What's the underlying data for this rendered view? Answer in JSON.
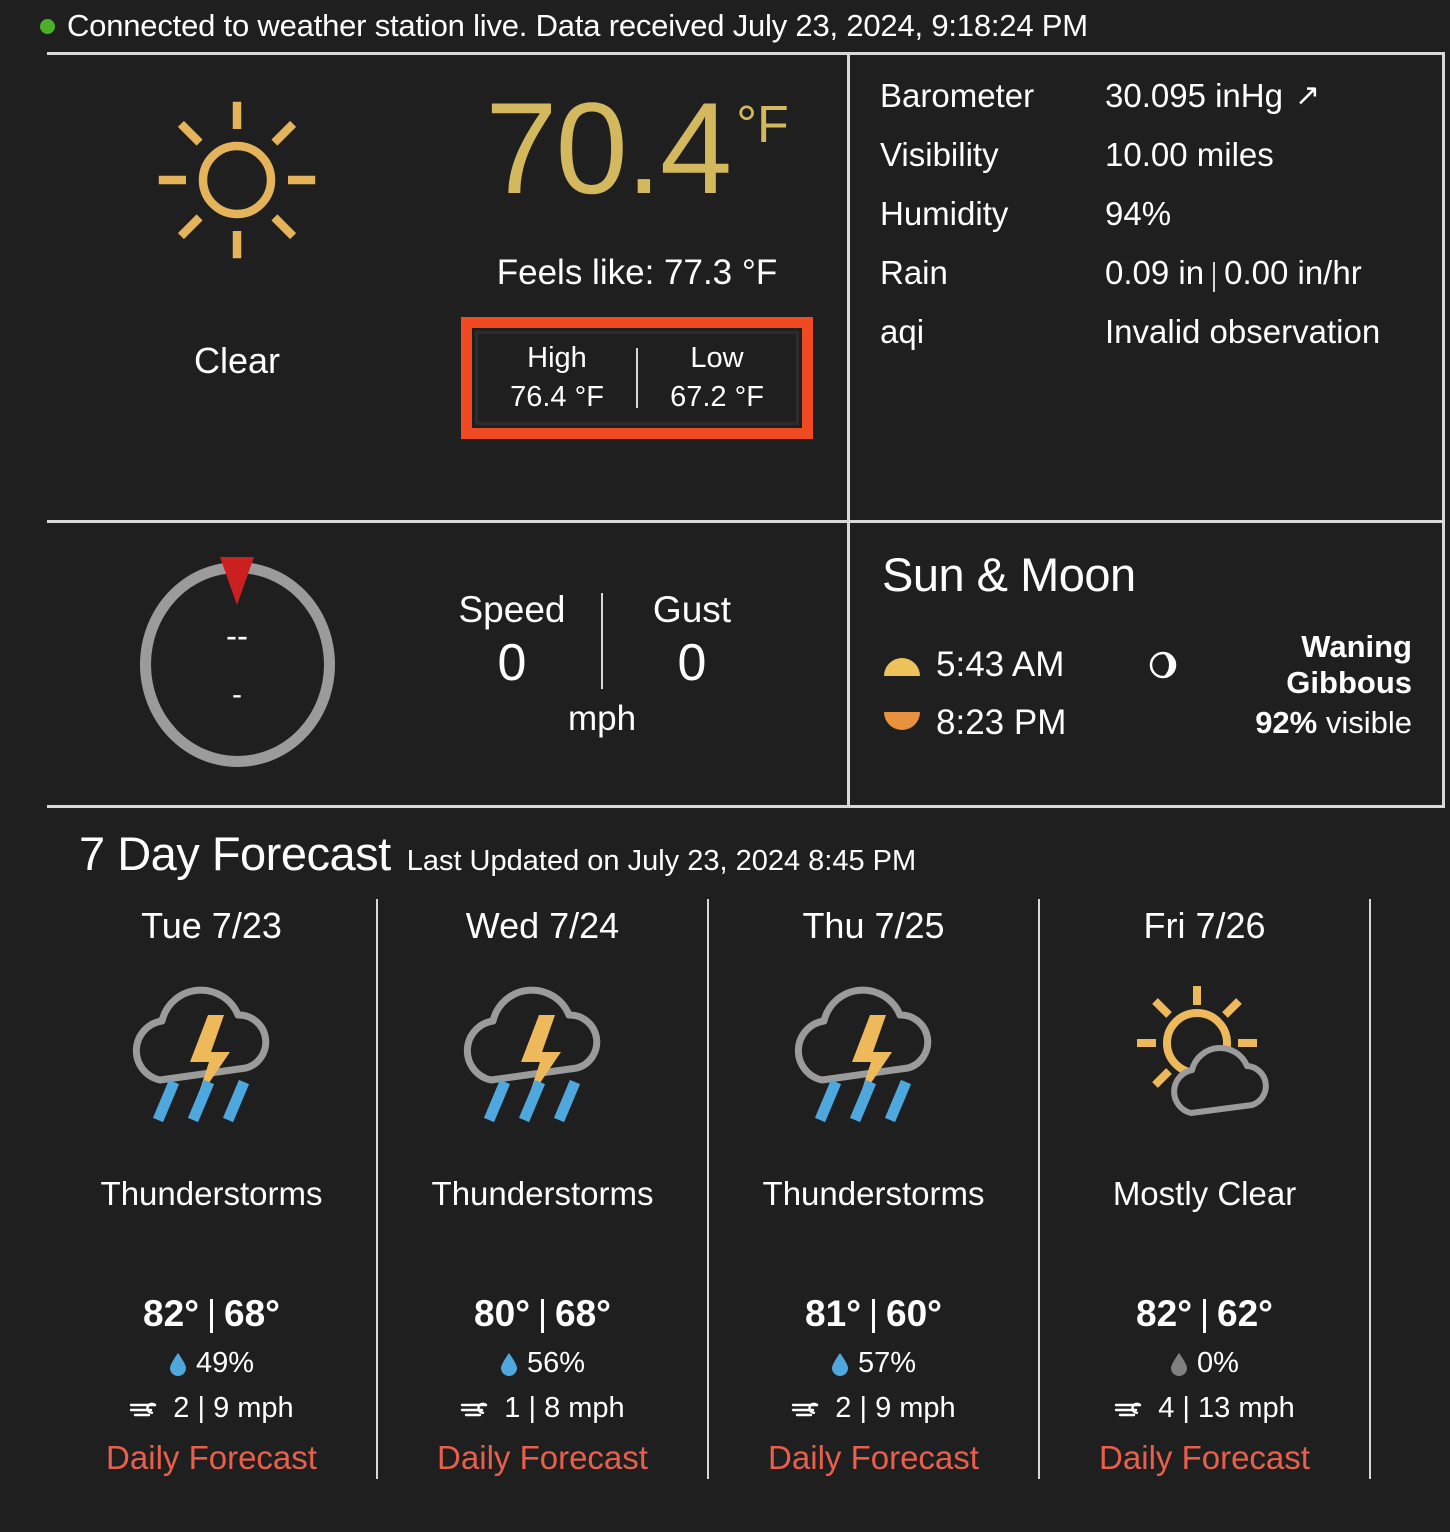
{
  "status": {
    "indicator_color": "#4caf28",
    "text": "Connected to weather station live. Data received July 23, 2024, 9:18:24 PM"
  },
  "current": {
    "condition_icon": "sun-icon",
    "condition": "Clear",
    "temperature": "70.4",
    "temperature_unit": "°F",
    "feels_like": "Feels like: 77.3 °F",
    "high_low": {
      "high_label": "High",
      "high_value": "76.4 °F",
      "low_label": "Low",
      "low_value": "67.2 °F",
      "highlight_color": "#f04a23"
    }
  },
  "observations": [
    {
      "key": "Barometer",
      "value": "30.095 inHg",
      "trend": "↗"
    },
    {
      "key": "Visibility",
      "value": "10.00 miles",
      "trend": ""
    },
    {
      "key": "Humidity",
      "value": "94%",
      "trend": ""
    },
    {
      "key": "Rain",
      "value": "0.09 in",
      "value2": "0.00 in/hr",
      "trend": ""
    },
    {
      "key": "aqi",
      "value": "Invalid observation",
      "trend": ""
    }
  ],
  "wind": {
    "direction_text": "--",
    "degrees_text": "-",
    "speed_label": "Speed",
    "speed_value": "0",
    "gust_label": "Gust",
    "gust_value": "0",
    "unit": "mph",
    "needle_color": "#cc2020"
  },
  "sun_moon": {
    "title": "Sun & Moon",
    "sunrise": "5:43 AM",
    "sunset": "8:23 PM",
    "moon_phase": "Waning Gibbous",
    "moon_visible_pct": "92%",
    "moon_visible_suffix": " visible"
  },
  "forecast": {
    "title": "7 Day Forecast",
    "last_updated": "Last Updated on July 23, 2024 8:45 PM",
    "link_label": "Daily Forecast",
    "link_color": "#e8604c",
    "days": [
      {
        "day": "Tue 7/23",
        "icon": "thunderstorm-icon",
        "desc": "Thunderstorms",
        "high": "82°",
        "low": "68°",
        "pop": "49%",
        "pop_color": "#4fa8dd",
        "wind": "2 | 9 mph",
        "link": "Daily Forecast"
      },
      {
        "day": "Wed 7/24",
        "icon": "thunderstorm-icon",
        "desc": "Thunderstorms",
        "high": "80°",
        "low": "68°",
        "pop": "56%",
        "pop_color": "#4fa8dd",
        "wind": "1 | 8 mph",
        "link": "Daily Forecast"
      },
      {
        "day": "Thu 7/25",
        "icon": "thunderstorm-icon",
        "desc": "Thunderstorms",
        "high": "81°",
        "low": "60°",
        "pop": "57%",
        "pop_color": "#4fa8dd",
        "wind": "2 | 9 mph",
        "link": "Daily Forecast"
      },
      {
        "day": "Fri 7/26",
        "icon": "sun-cloud-icon",
        "desc": "Mostly Clear",
        "high": "82°",
        "low": "62°",
        "pop": "0%",
        "pop_color": "#808080",
        "wind": "4 | 13 mph",
        "link": "Daily Forecast"
      }
    ]
  }
}
